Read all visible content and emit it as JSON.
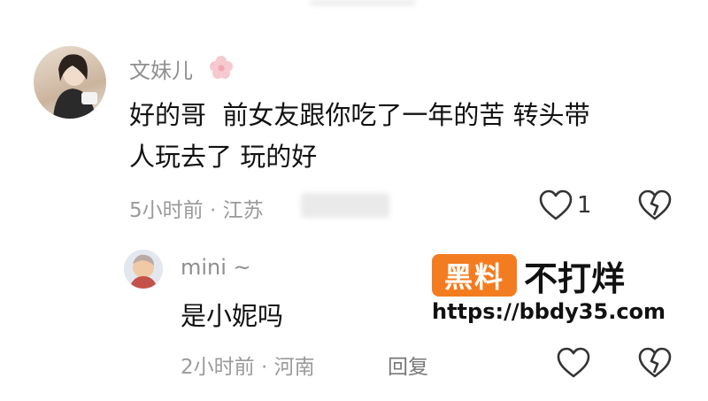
{
  "comment": {
    "username": "文妹儿",
    "text_line1": "好的哥  前女友跟你吃了一年的苦 转头带",
    "text_line2": "人玩去了 玩的好",
    "time": "5小时前",
    "location": "江苏",
    "like_count": "1"
  },
  "reply": {
    "username": "mini ~",
    "text": "是小妮吗",
    "time": "2小时前",
    "location": "河南",
    "reply_label": "回复"
  },
  "watermark": {
    "badge": "黑料",
    "title": "不打烊",
    "url": "https://bbdy35.com"
  },
  "colors": {
    "badge": "#f47c20",
    "meta_text": "#9a9a9a",
    "username": "#8f8f8f"
  },
  "icons": [
    "flower-icon",
    "heart-icon",
    "broken-heart-icon"
  ]
}
